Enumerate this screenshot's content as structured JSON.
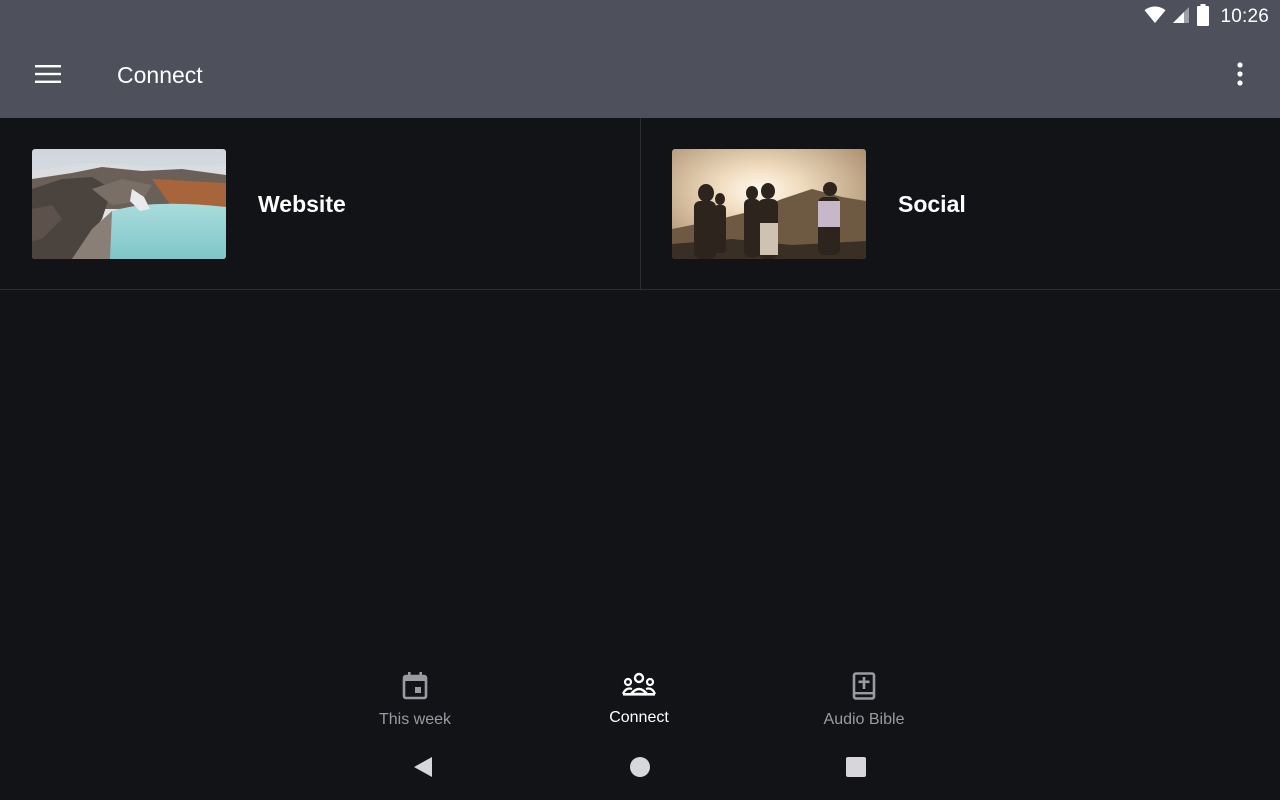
{
  "status_bar": {
    "time": "10:26",
    "icons": [
      "wifi-icon",
      "cellular-signal-icon",
      "battery-icon"
    ]
  },
  "app_bar": {
    "title": "Connect",
    "left_icon": "hamburger-menu-icon",
    "right_icon": "more-vert-icon",
    "background": "#4e505c"
  },
  "cards": [
    {
      "label": "Website",
      "thumbnail": "crater-lake-landscape"
    },
    {
      "label": "Social",
      "thumbnail": "friends-at-sunset"
    }
  ],
  "bottom_nav": {
    "items": [
      {
        "label": "This week",
        "icon": "calendar-event-icon",
        "active": false
      },
      {
        "label": "Connect",
        "icon": "people-group-icon",
        "active": true
      },
      {
        "label": "Audio Bible",
        "icon": "bible-icon",
        "active": false
      }
    ],
    "active_color": "#ffffff",
    "inactive_color": "#9a9ba2"
  },
  "system_nav": {
    "buttons": [
      "back-icon",
      "home-icon",
      "recents-icon"
    ]
  },
  "colors": {
    "background": "#121316",
    "divider": "#2c2d32"
  }
}
